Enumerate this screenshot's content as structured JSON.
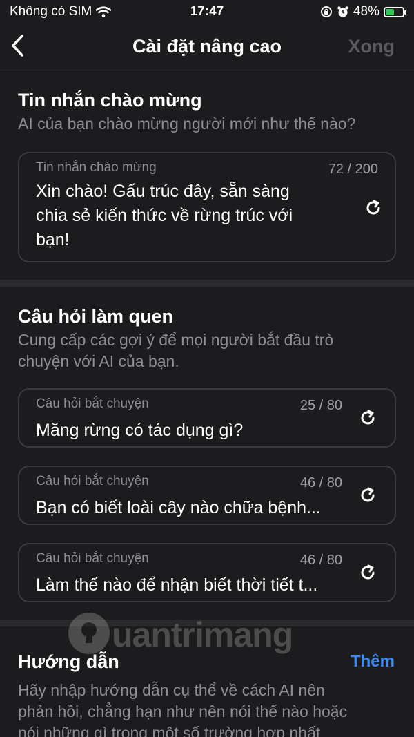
{
  "status": {
    "carrier": "Không có SIM",
    "time": "17:47",
    "battery_pct": "48%",
    "battery_level": 0.48,
    "icons": [
      "wifi-icon",
      "rotation-lock-icon",
      "alarm-icon",
      "battery-charging-icon"
    ]
  },
  "nav": {
    "back_icon": "chevron-left-icon",
    "title": "Cài đặt nâng cao",
    "done_label": "Xong"
  },
  "greeting": {
    "title": "Tin nhắn chào mừng",
    "description": "AI của bạn chào mừng người mới như thế nào?",
    "field_label": "Tin nhắn chào mừng",
    "count": "72 / 200",
    "line1": "Xin chào! Gấu trúc đây, sẵn sàng",
    "line2": "chia sẻ kiến thức về rừng trúc với",
    "line3": "bạn!"
  },
  "starters": {
    "title": "Câu hỏi làm quen",
    "description_line1": "Cung cấp các gợi ý để mọi người bắt đầu trò",
    "description_line2": "chuyện với AI của bạn.",
    "items": [
      {
        "label": "Câu hỏi bắt chuyện",
        "count": "25 / 80",
        "text": "Măng rừng có tác dụng gì?"
      },
      {
        "label": "Câu hỏi bắt chuyện",
        "count": "46 / 80",
        "text": "Bạn có biết loài cây nào chữa bệnh..."
      },
      {
        "label": "Câu hỏi bắt chuyện",
        "count": "46 / 80",
        "text": "Làm thế nào để nhận biết thời tiết t..."
      }
    ]
  },
  "instructions": {
    "title": "Hướng dẫn",
    "add_label": "Thêm",
    "line1": "Hãy nhập hướng dẫn cụ thể về cách AI nên",
    "line2": "phản hồi, chẳng hạn như nên nói thế nào hoặc",
    "line3": "nói những gì trong một số trường hợp nhất"
  },
  "watermark": {
    "text": "uantrimang"
  },
  "colors": {
    "accent": "#3b8bf0",
    "background": "#1c1c1e",
    "muted": "#8e8e93"
  }
}
